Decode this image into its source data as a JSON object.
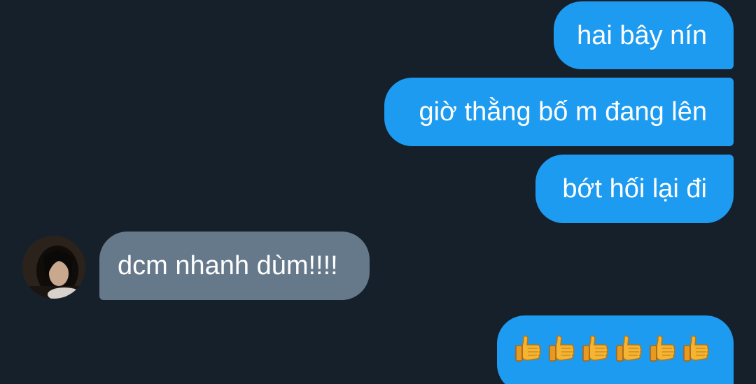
{
  "messages": [
    {
      "id": "m1",
      "sender": "me",
      "text": "hai bây nín"
    },
    {
      "id": "m2",
      "sender": "me",
      "text": "giờ thằng bố m đang lên"
    },
    {
      "id": "m3",
      "sender": "me",
      "text": "bớt hối lại đi"
    },
    {
      "id": "m4",
      "sender": "other",
      "text": "dcm nhanh dùm!!!!"
    },
    {
      "id": "m5",
      "sender": "me",
      "text": "👍👍👍👍👍👍",
      "emoji_icon": "thumbs-up-icon",
      "emoji_count": 6
    }
  ],
  "colors": {
    "background": "#16202a",
    "outgoing_bubble": "#1d9bf0",
    "incoming_bubble": "#66798b",
    "text": "#ffffff"
  }
}
